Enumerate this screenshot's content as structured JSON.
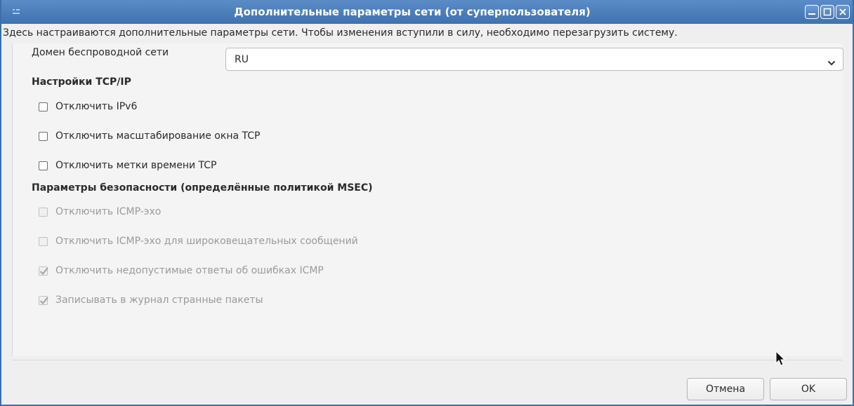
{
  "window": {
    "title": "Дополнительные параметры сети (от суперпользователя)",
    "app_icon": "app-menu-icon",
    "controls": [
      "minimize-icon",
      "maximize-icon",
      "close-icon"
    ]
  },
  "info_text": "Здесь настраиваются дополнительные параметры сети. Чтобы изменения вступили в силу, необходимо перезагрузить систему.",
  "wireless_domain": {
    "label": "Домен беспроводной сети",
    "value": "RU"
  },
  "tcpip": {
    "heading": "Настройки TCP/IP",
    "options": [
      {
        "label": "Отключить IPv6",
        "checked": false,
        "enabled": true
      },
      {
        "label": "Отключить масштабирование окна TCP",
        "checked": false,
        "enabled": true
      },
      {
        "label": "Отключить метки времени TCP",
        "checked": false,
        "enabled": true
      }
    ]
  },
  "security": {
    "heading": "Параметры безопасности (определённые политикой MSEC)",
    "options": [
      {
        "label": "Отключить ICMP-эхо",
        "checked": false,
        "enabled": false
      },
      {
        "label": "Отключить ICMP-эхо для широковещательных сообщений",
        "checked": false,
        "enabled": false
      },
      {
        "label": "Отключить недопустимые ответы об ошибках ICMP",
        "checked": true,
        "enabled": false
      },
      {
        "label": "Записывать в журнал странные пакеты",
        "checked": true,
        "enabled": false
      }
    ]
  },
  "buttons": {
    "cancel": "Отмена",
    "ok": "OK"
  },
  "colors": {
    "titlebar": "#4a7cb8",
    "window_bg": "#efefef",
    "disabled_text": "#9a9a9a"
  }
}
